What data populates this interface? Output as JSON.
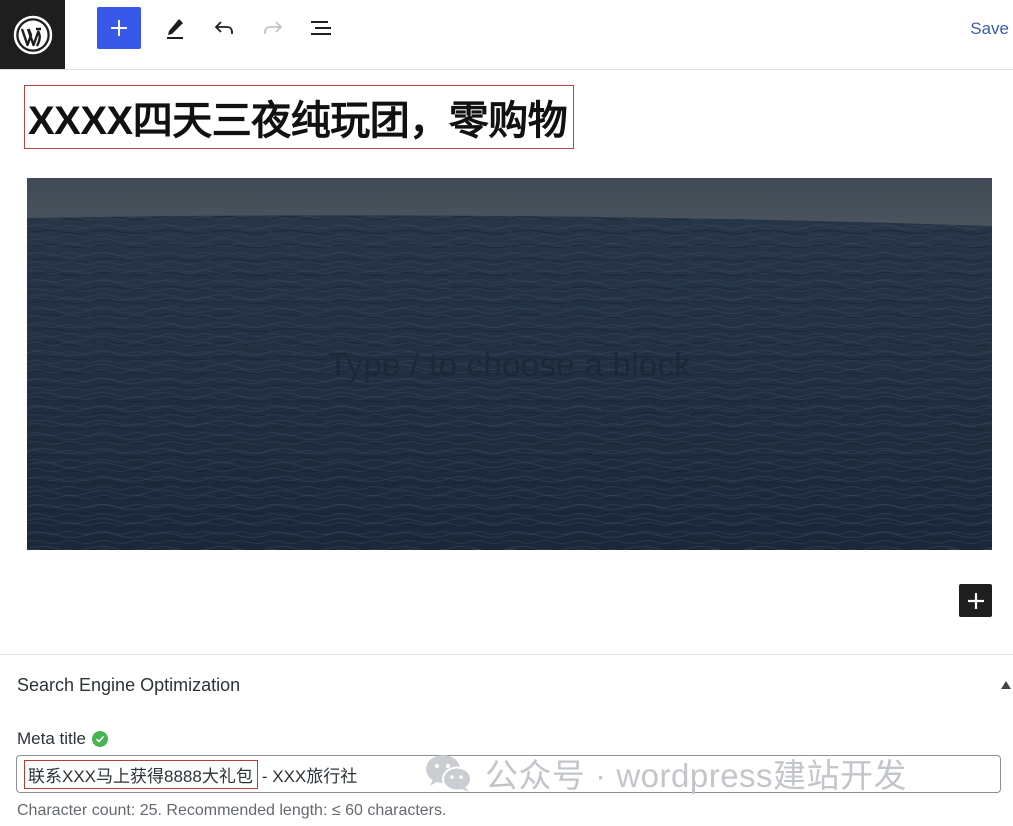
{
  "toolbar": {
    "logo_icon": "wordpress-logo-icon",
    "add_block_icon": "plus-icon",
    "tools_icon": "pencil-icon",
    "undo_icon": "undo-icon",
    "redo_icon": "redo-icon",
    "outline_icon": "list-view-icon",
    "save_label": "Save",
    "accent_color": "#3858e9"
  },
  "editor": {
    "post_title": "XXXX四天三夜纯玩团，零购物",
    "cover_placeholder": "Type / to choose a block",
    "cover_image": "dark ocean waves under grey sky",
    "append_block_icon": "plus-icon"
  },
  "seo": {
    "panel_title": "Search Engine Optimization",
    "meta_title_label": "Meta title",
    "meta_title_status_icon": "check-circle-icon",
    "meta_title_highlighted": "联系XXX马上获得8888大礼包",
    "meta_title_rest": "- XXX旅行社",
    "char_count_text": "Character count: 25. Recommended length: ≤ 60 characters."
  },
  "watermark": {
    "text": "公众号 · wordpress建站开发"
  }
}
